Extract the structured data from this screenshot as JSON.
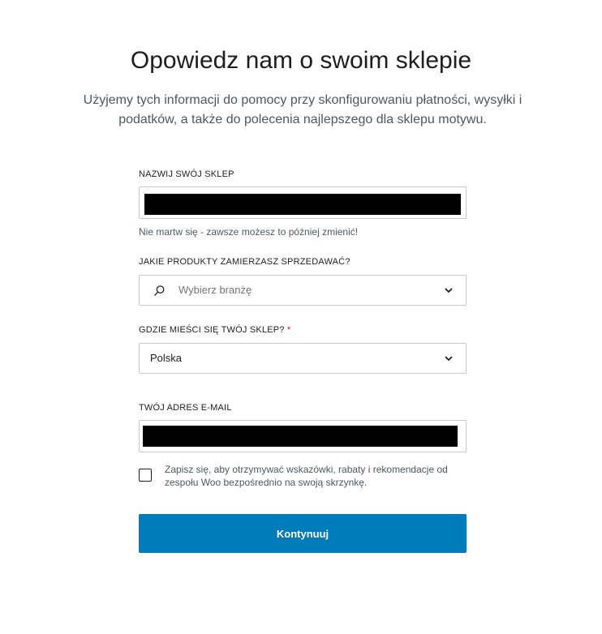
{
  "header": {
    "title": "Opowiedz nam o swoim sklepie",
    "subtitle": "Użyjemy tych informacji do pomocy przy skonfigurowaniu płatności, wysyłki i podatków, a także do polecenia najlepszego dla sklepu motywu."
  },
  "store_name": {
    "label": "NAZWIJ SWÓJ SKLEP",
    "value": "",
    "help": "Nie martw się - zawsze możesz to później zmienić!"
  },
  "industry": {
    "label": "JAKIE PRODUKTY ZAMIERZASZ SPRZEDAWAĆ?",
    "placeholder": "Wybierz branżę",
    "search_icon": "search-icon",
    "chevron_icon": "chevron-down-icon"
  },
  "location": {
    "label": "GDZIE MIEŚCI SIĘ TWÓJ SKLEP?",
    "required_mark": "*",
    "value": "Polska",
    "chevron_icon": "chevron-down-icon"
  },
  "email": {
    "label": "TWÓJ ADRES E-MAIL",
    "value": ""
  },
  "newsletter": {
    "label": "Zapisz się, aby otrzymywać wskazówki, rabaty i rekomendacje od zespołu Woo bezpośrednio na swoją skrzynkę.",
    "checked": false
  },
  "continue_button": {
    "label": "Kontynuuj"
  },
  "colors": {
    "primary": "#007cba",
    "required": "#cc1818",
    "text": "#1e1e1e",
    "muted": "#50575e"
  }
}
